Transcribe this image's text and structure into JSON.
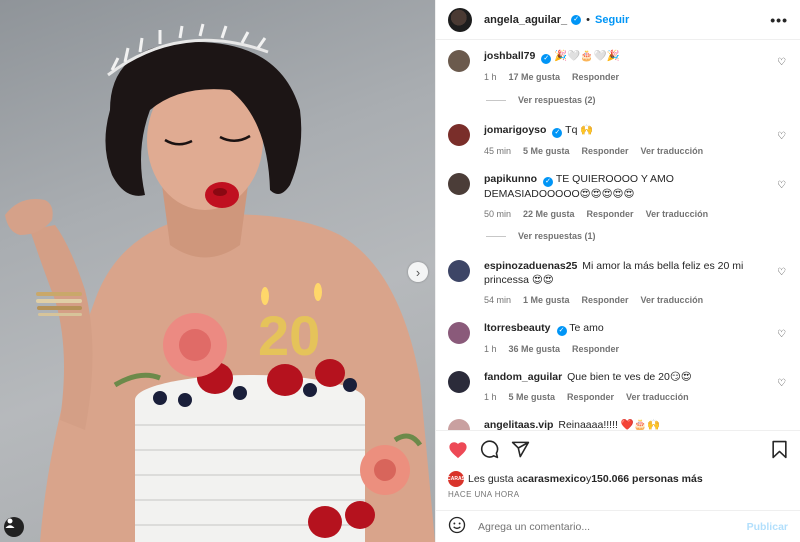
{
  "header": {
    "username": "angela_aguilar_",
    "separator": "•",
    "follow_label": "Seguir",
    "more_label": "•••"
  },
  "comments": [
    {
      "user": "joshball79",
      "verified": true,
      "text": "🎉🤍🎂🤍🎉",
      "time": "1 h",
      "likes": "17 Me gusta",
      "reply": "Responder",
      "translate": "",
      "replies": "Ver respuestas (2)"
    },
    {
      "user": "jomarigoyso",
      "verified": true,
      "text": "Tq 🙌",
      "time": "45 min",
      "likes": "5 Me gusta",
      "reply": "Responder",
      "translate": "Ver traducción",
      "replies": ""
    },
    {
      "user": "papikunno",
      "verified": true,
      "text": "TE QUIEROOOO Y AMO DEMASIADOOOOO😍😍😍😍😍",
      "time": "50 min",
      "likes": "22 Me gusta",
      "reply": "Responder",
      "translate": "Ver traducción",
      "replies": "Ver respuestas (1)"
    },
    {
      "user": "espinozaduenas25",
      "verified": false,
      "text": "Mi amor la más bella feliz es 20 mi princessa 😍😍",
      "time": "54 min",
      "likes": "1 Me gusta",
      "reply": "Responder",
      "translate": "Ver traducción",
      "replies": ""
    },
    {
      "user": "ltorresbeauty",
      "verified": true,
      "text": "Te amo",
      "time": "1 h",
      "likes": "36 Me gusta",
      "reply": "Responder",
      "translate": "",
      "replies": ""
    },
    {
      "user": "fandom_aguilar",
      "verified": false,
      "text": "Que bien te ves de 20😏😍",
      "time": "1 h",
      "likes": "5 Me gusta",
      "reply": "Responder",
      "translate": "Ver traducción",
      "replies": ""
    },
    {
      "user": "angelitaas.vip",
      "verified": false,
      "text": "Reinaaaa!!!!! ❤️🎂🙌",
      "time": "",
      "likes": "",
      "reply": "",
      "translate": "",
      "replies": ""
    }
  ],
  "likes": {
    "prefix": "Les gusta a ",
    "user": "carasmexico",
    "middle": " y ",
    "count": "150.066 personas más",
    "avatar_text": "CARAS"
  },
  "post_time": "HACE UNA HORA",
  "add_comment": {
    "placeholder": "Agrega un comentario...",
    "publish_label": "Publicar"
  },
  "icons": {
    "like": "heart-filled-icon",
    "comment": "comment-icon",
    "share": "share-icon",
    "save": "bookmark-icon"
  },
  "colors": {
    "accent": "#0095f6",
    "like": "#ed4956",
    "publish_disabled": "#b2dffc"
  }
}
